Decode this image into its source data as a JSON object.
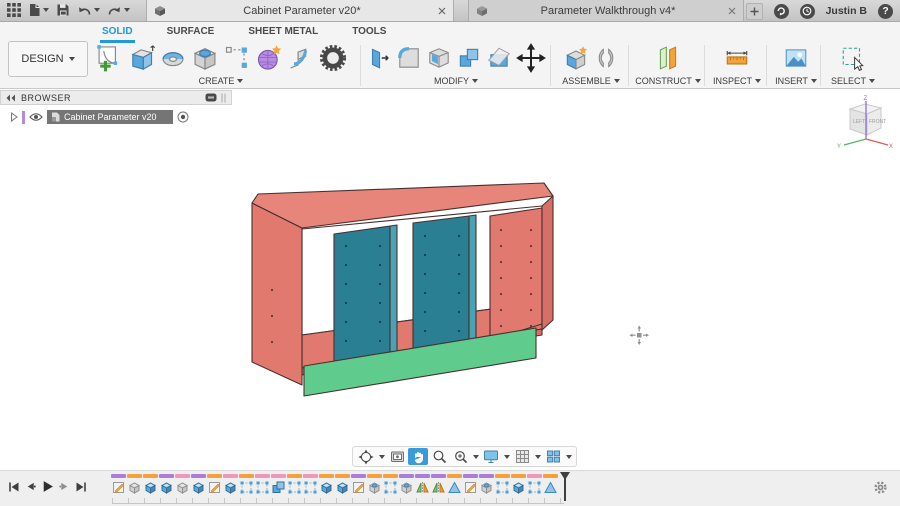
{
  "title_bar": {
    "tabs": [
      {
        "label": "Cabinet Parameter v20*"
      },
      {
        "label": "Parameter Walkthrough v4*"
      }
    ],
    "user_name": "Justin B",
    "help_glyph": "?"
  },
  "ribbon": {
    "workspace_label": "DESIGN",
    "tabs": [
      {
        "label": "SOLID"
      },
      {
        "label": "SURFACE"
      },
      {
        "label": "SHEET METAL"
      },
      {
        "label": "TOOLS"
      }
    ],
    "active_tab": "SOLID",
    "groups": [
      {
        "label": "CREATE"
      },
      {
        "label": "MODIFY"
      },
      {
        "label": "ASSEMBLE"
      },
      {
        "label": "CONSTRUCT"
      },
      {
        "label": "INSPECT"
      },
      {
        "label": "INSERT"
      },
      {
        "label": "SELECT"
      }
    ]
  },
  "browser": {
    "header_label": "BROWSER",
    "document_name": "Cabinet Parameter v20"
  },
  "viewcube": {
    "front_label": "FRONT",
    "left_label": "LEFT",
    "axis_x": "X",
    "axis_y": "Y",
    "axis_z": "Z"
  },
  "model": {
    "name": "cabinet-carcass",
    "colors": {
      "carcass": "#e2796f",
      "carcass_top": "#e8857b",
      "carcass_edge": "#d96e65",
      "divider": "#2b7f92",
      "divider_edge": "#4aa3b4",
      "toe_kick": "#5fcb8c",
      "outline": "#46302f"
    }
  },
  "view_toolbar": {
    "buttons": [
      "orbit",
      "look-at",
      "pan",
      "zoom",
      "zoom-window",
      "display-settings",
      "grid-settings",
      "viewports"
    ],
    "active_button": "pan"
  },
  "timeline": {
    "playback": [
      "skip-to-start",
      "step-back",
      "play",
      "step-forward",
      "skip-to-end"
    ],
    "bar_colors": {
      "purple": "#a87ddc",
      "orange": "#f3a13c",
      "pink": "#f295bb"
    },
    "items": [
      {
        "type": "sketch",
        "bar": "purple"
      },
      {
        "type": "box",
        "bar": "orange"
      },
      {
        "type": "extrude",
        "bar": "orange"
      },
      {
        "type": "extrude",
        "bar": "purple"
      },
      {
        "type": "box",
        "bar": "pink"
      },
      {
        "type": "extrude",
        "bar": "purple"
      },
      {
        "type": "sketch",
        "bar": "orange"
      },
      {
        "type": "extrude",
        "bar": "pink"
      },
      {
        "type": "pattern",
        "bar": "orange"
      },
      {
        "type": "pattern",
        "bar": "pink"
      },
      {
        "type": "combine",
        "bar": "pink"
      },
      {
        "type": "pattern",
        "bar": "orange"
      },
      {
        "type": "pattern",
        "bar": "pink"
      },
      {
        "type": "extrude",
        "bar": "orange"
      },
      {
        "type": "extrude",
        "bar": "orange"
      },
      {
        "type": "sketch",
        "bar": "purple"
      },
      {
        "type": "hole",
        "bar": "orange"
      },
      {
        "type": "pattern",
        "bar": "orange"
      },
      {
        "type": "hole",
        "bar": "purple"
      },
      {
        "type": "mirror",
        "bar": "purple"
      },
      {
        "type": "mirror",
        "bar": "purple"
      },
      {
        "type": "triangle",
        "bar": "orange"
      },
      {
        "type": "sketch",
        "bar": "purple"
      },
      {
        "type": "hole",
        "bar": "purple"
      },
      {
        "type": "pattern",
        "bar": "orange"
      },
      {
        "type": "extrude",
        "bar": "orange"
      },
      {
        "type": "pattern",
        "bar": "pink"
      },
      {
        "type": "triangle",
        "bar": "orange"
      }
    ]
  },
  "colors": {
    "accent_blue": "#1f9ad6",
    "pan_active": "#3b9ad9",
    "titlebar": "#cccccc",
    "ribbon_bg": "#f4f4f4"
  }
}
